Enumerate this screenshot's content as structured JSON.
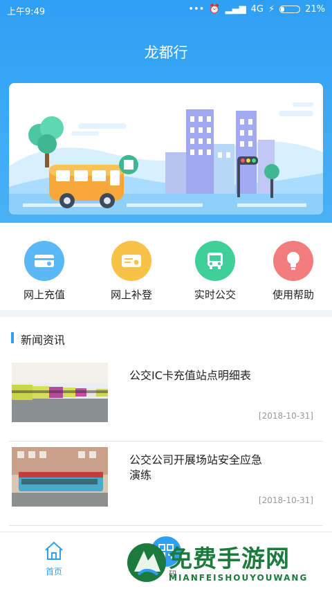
{
  "status": {
    "time": "上午9:49",
    "network": "4G",
    "battery": "21%",
    "battery_level": 0.21
  },
  "app": {
    "title": "龙都行"
  },
  "quick_actions": [
    {
      "label": "网上充值",
      "icon": "card-icon",
      "color": "#5ab8f7"
    },
    {
      "label": "网上补登",
      "icon": "ticket-icon",
      "color": "#f7c245"
    },
    {
      "label": "实时公交",
      "icon": "bus-icon",
      "color": "#3fd09a"
    },
    {
      "label": "使用帮助",
      "icon": "lightbulb-icon",
      "color": "#f37d7d"
    }
  ],
  "news": {
    "section_title": "新闻资讯",
    "items": [
      {
        "title": "公交IC卡充值站点明细表",
        "date": "[2018-10-31]"
      },
      {
        "title": "公交公司开展场站安全应急演练",
        "date": "[2018-10-31]"
      }
    ]
  },
  "tabbar": {
    "home_label": "首页",
    "center_label": "码"
  },
  "watermark": {
    "main": "免费手游网",
    "sub": "MIANFEISHOUYOUWANG"
  },
  "colors": {
    "primary": "#2f9ff4",
    "watermark": "#1c7a3d"
  }
}
